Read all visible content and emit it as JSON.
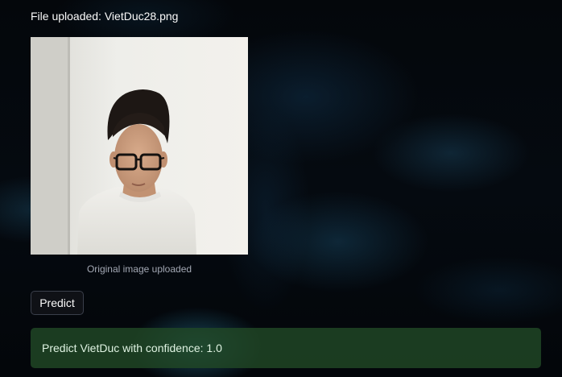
{
  "upload": {
    "file_label": "File uploaded: VietDuc28.png"
  },
  "image": {
    "caption": "Original image uploaded"
  },
  "actions": {
    "predict_label": "Predict"
  },
  "result": {
    "message": "Predict VietDuc with confidence: 1.0",
    "status": "success"
  },
  "colors": {
    "background": "#04070a",
    "text": "#fafafa",
    "caption": "#a3a8b4",
    "button_border": "#3a3f4b",
    "success_bg": "#214826",
    "success_text": "#dff3e2"
  }
}
